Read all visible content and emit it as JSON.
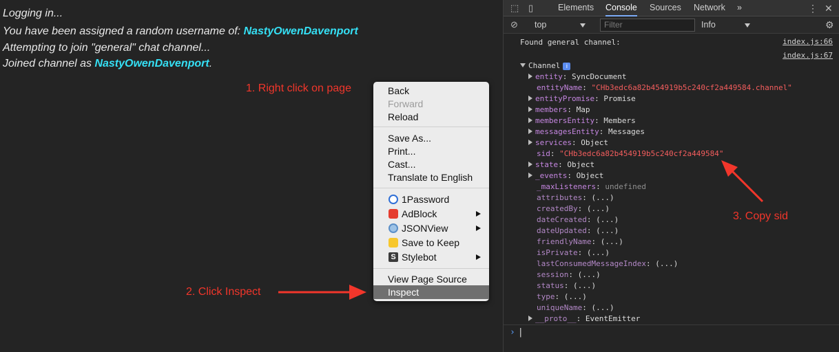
{
  "page": {
    "log": [
      {
        "text": "Logging in...",
        "user": ""
      },
      {
        "text": "You have been assigned a random username of: ",
        "user": "NastyOwenDavenport"
      },
      {
        "text": "Attempting to join \"general\" chat channel...",
        "user": ""
      },
      {
        "text": "Joined channel as ",
        "user": "NastyOwenDavenport",
        "suffix": "."
      }
    ],
    "annotations": {
      "step1": "1. Right click on page",
      "step2": "2. Click Inspect",
      "step3": "3. Copy sid"
    }
  },
  "context_menu": {
    "items": {
      "back": "Back",
      "forward": "Forward",
      "reload": "Reload",
      "save_as": "Save As...",
      "print": "Print...",
      "cast": "Cast...",
      "translate": "Translate to English",
      "onepassword": "1Password",
      "adblock": "AdBlock",
      "jsonview": "JSONView",
      "save_to_keep": "Save to Keep",
      "stylebot": "Stylebot",
      "view_source": "View Page Source",
      "inspect": "Inspect"
    }
  },
  "devtools": {
    "tabs": {
      "elements": "Elements",
      "console": "Console",
      "sources": "Sources",
      "network": "Network",
      "more": "»"
    },
    "toolbar": {
      "context": "top",
      "filter_placeholder": "Filter",
      "level": "Info"
    },
    "console": {
      "msg1": "Found general channel:",
      "src1": "index.js:66",
      "src2": "index.js:67",
      "channel_label": "Channel",
      "info_badge": "i",
      "props": {
        "entity_k": "entity",
        "entity_v": "SyncDocument",
        "entityName_k": "entityName",
        "entityName_v": "\"CHb3edc6a82b454919b5c240cf2a449584.channel\"",
        "entityPromise_k": "entityPromise",
        "entityPromise_v": "Promise",
        "members_k": "members",
        "members_v": "Map",
        "membersEntity_k": "membersEntity",
        "membersEntity_v": "Members",
        "messagesEntity_k": "messagesEntity",
        "messagesEntity_v": "Messages",
        "services_k": "services",
        "services_v": "Object",
        "sid_k": "sid",
        "sid_v": "\"CHb3edc6a82b454919b5c240cf2a449584\"",
        "state_k": "state",
        "state_v": "Object",
        "events_k": "_events",
        "events_v": "Object",
        "maxListeners_k": "_maxListeners",
        "maxListeners_v": "undefined",
        "attributes_k": "attributes",
        "attributes_v": "(...)",
        "createdBy_k": "createdBy",
        "createdBy_v": "(...)",
        "dateCreated_k": "dateCreated",
        "dateCreated_v": "(...)",
        "dateUpdated_k": "dateUpdated",
        "dateUpdated_v": "(...)",
        "friendlyName_k": "friendlyName",
        "friendlyName_v": "(...)",
        "isPrivate_k": "isPrivate",
        "isPrivate_v": "(...)",
        "lastConsumed_k": "lastConsumedMessageIndex",
        "lastConsumed_v": "(...)",
        "session_k": "session",
        "session_v": "(...)",
        "status_k": "status",
        "status_v": "(...)",
        "type_k": "type",
        "type_v": "(...)",
        "uniqueName_k": "uniqueName",
        "uniqueName_v": "(...)",
        "proto_k": "__proto__",
        "proto_v": "EventEmitter"
      },
      "prompt": "›"
    }
  },
  "colors": {
    "annotation": "#f2362b",
    "username": "#35e0f5",
    "string": "#f35d5d",
    "key": "#c586e0"
  }
}
